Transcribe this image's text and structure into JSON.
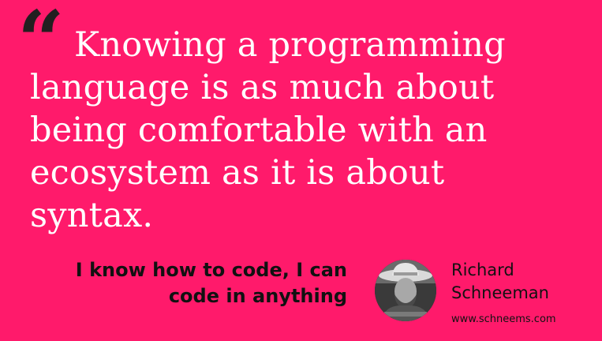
{
  "quote": {
    "mark": "“",
    "text": "Knowing a programming language is as much about being comfortable with an ecosystem as it is about syntax."
  },
  "talk": {
    "title": "I know how to code, I can code in anything"
  },
  "author": {
    "name": "Richard Schneeman",
    "website": "www.schneems.com",
    "avatar_icon": "author-photo"
  },
  "colors": {
    "background": "#ff1a6b",
    "quote_text": "#ffffff",
    "dark_text": "#111111"
  }
}
